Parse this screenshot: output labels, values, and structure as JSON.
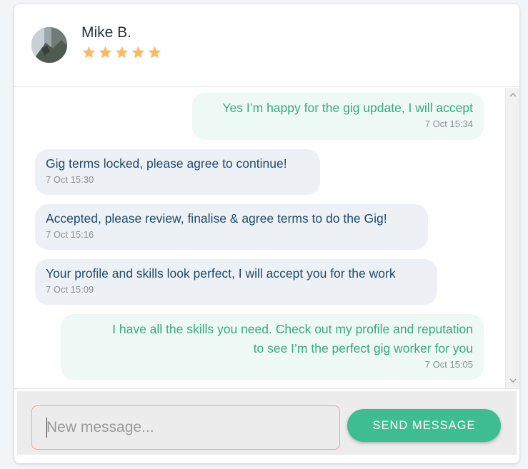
{
  "contact": {
    "name": "Mike B.",
    "rating": 5,
    "star_color": "#f7bb68"
  },
  "messages": [
    {
      "direction": "outgoing",
      "text": "Yes I’m happy for the gig update, I will accept",
      "time": "7 Oct 15:34"
    },
    {
      "direction": "incoming",
      "text": "Gig terms locked, please agree to continue!",
      "time": "7 Oct 15:30"
    },
    {
      "direction": "incoming",
      "text": "Accepted, please review, finalise & agree terms to do the Gig!",
      "time": "7 Oct 15:16"
    },
    {
      "direction": "incoming",
      "text": "Your profile and skills look perfect, I will accept you for the work",
      "time": "7 Oct 15:09"
    },
    {
      "direction": "outgoing",
      "text_lines": [
        "I have all the skills you need. Check out my profile and reputation",
        "to see I’m the perfect gig worker for you"
      ],
      "time": "7 Oct 15:05"
    }
  ],
  "composer": {
    "placeholder": "New message...",
    "value": "",
    "send_label": "SEND MESSAGE"
  },
  "colors": {
    "incoming_bubble": "#edf1f6",
    "incoming_text": "#1e4a68",
    "outgoing_bubble": "#eef8f4",
    "outgoing_text": "#3aa883",
    "send_button": "#3dbd91",
    "input_border": "#f1a58c"
  }
}
